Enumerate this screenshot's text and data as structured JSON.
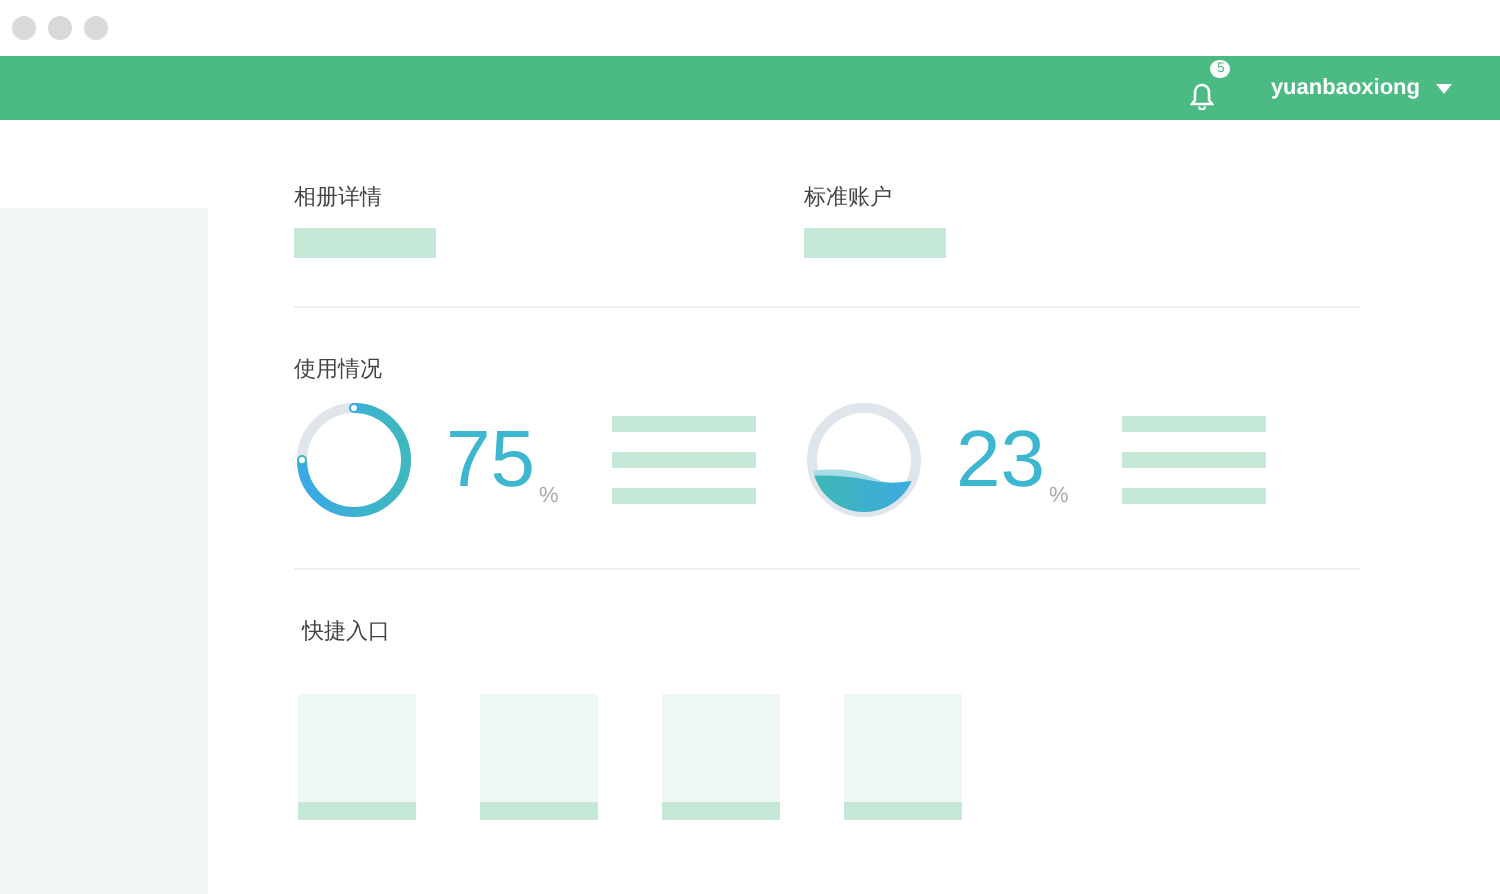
{
  "header": {
    "notification_count": "5",
    "username": "yuanbaoxiong"
  },
  "account": [
    {
      "label": "相册详情"
    },
    {
      "label": "标准账户"
    }
  ],
  "usage": {
    "title": "使用情况",
    "gauges": [
      {
        "kind": "ring",
        "value": "75",
        "unit": "%",
        "level": 0.75
      },
      {
        "kind": "wave",
        "value": "23",
        "unit": "%"
      }
    ]
  },
  "shortcuts": {
    "title": "快捷入口"
  }
}
